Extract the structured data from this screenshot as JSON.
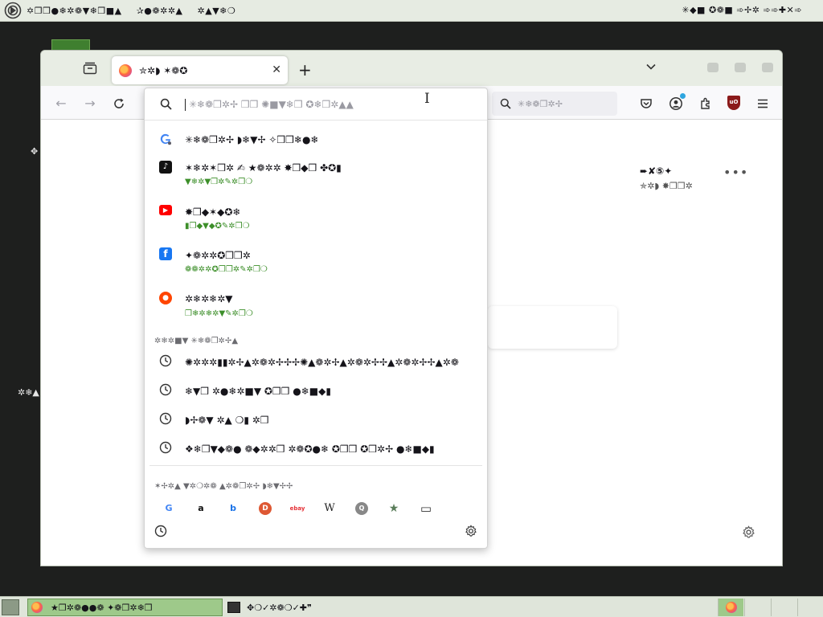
{
  "top_panel": {
    "menu_items": [
      "✡❒❒●❄✲❁▼❄❒■▲",
      "✰●❁✲✲▲",
      "✲▲▼❄❍"
    ],
    "clock": "✳◆■ ✪❁■ ➾✢✲ ➾➾✚✕➾"
  },
  "desktop": {
    "mark1": "✥",
    "mark2": "✲❄▲"
  },
  "browser": {
    "tab": {
      "title": "✮✲◗ ✶❁✪",
      "close_glyph": "✕"
    },
    "new_tab_glyph": "+",
    "navbar": {
      "search_placeholder": "✳❄❁❒✲✢",
      "ublock_label": "uO"
    },
    "urlbar": {
      "placeholder": "✳❄❁❒✲✢ ❒❒ ✺■▼❄❒ ✪❄❒✲▲▲"
    },
    "content": {
      "tile_title": "➨✘⑤✦",
      "tile_sub": "✯✲◗ ✸❒❒✲",
      "tile_more": "•••"
    }
  },
  "dropdown": {
    "results": [
      {
        "icon": "google-icon",
        "title": "✳❄❁❒✲✢ ◗❄▼✢ ✧❒❒❄●❄",
        "url": ""
      },
      {
        "icon": "tiktok-icon",
        "title": "✶❄✲✶❒✲ ✍ ★❁✲✲ ✸❒◆❒ ✤✪▮",
        "url": "▼❄✲▼❒✲✎✲❒❍"
      },
      {
        "icon": "youtube-icon",
        "title": "✸❒◆✶◆✪❄",
        "url": "▮❒◆▼◆✪✎✲❒❍"
      },
      {
        "icon": "facebook-icon",
        "title": "✦❁✲✲✪❒❒✲",
        "url": "❁❁✲✲✪❒❒✲✎✲❒❍"
      },
      {
        "icon": "reddit-icon",
        "title": "✲❄✲❄✲▼",
        "url": "❒❄✲❄✲▼✎✲❒❍"
      }
    ],
    "history_header": "✲❄✲■▼ ✳❄❁❒✲✢▲",
    "history": [
      "✺✲✲✲▮▮✲✢▲✲❁✲✢✢✢✺▲❁✲✢▲✲❁✲✢✢▲✲❁✲✢✢▲✲❁",
      "❄▼❒ ✲●❄✲■▼ ✪❒❒ ●❄■◆▮",
      "◗✢❁▼ ✲▲ ❍▮ ✲❒",
      "❖❄❒▼◆❁● ❁◆✲✲❒ ✲❁✪●❄ ✪❒❒ ✪❒✲✢ ●❄■◆▮"
    ],
    "engines_header": "✶✢✲▲ ▼✲❍✲❁ ▲✲❁❒✲✢ ◗❄▼✢✢",
    "engines": [
      {
        "name": "google-icon",
        "glyph": "G",
        "color": "#4285f4"
      },
      {
        "name": "amazon-icon",
        "glyph": "a",
        "color": "#111111"
      },
      {
        "name": "bing-icon",
        "glyph": "b",
        "color": "#1a73e8"
      },
      {
        "name": "duckduckgo-icon",
        "glyph": "D",
        "color": "#de5833"
      },
      {
        "name": "ebay-icon",
        "glyph": "ebay",
        "color": "#e53238"
      },
      {
        "name": "wikipedia-icon",
        "glyph": "W",
        "color": "#222222"
      },
      {
        "name": "search-engine-icon",
        "glyph": "Q",
        "color": "#777777"
      },
      {
        "name": "bookmarks-icon",
        "glyph": "★",
        "color": "#5a7d5a"
      },
      {
        "name": "tabs-icon",
        "glyph": "▭",
        "color": "#333333"
      }
    ]
  },
  "taskbar": {
    "task1": "★❒✲❁●●❁ ✦❁❒✲❄❒",
    "task2": "✥❍✓✲❁❍✓✚❞"
  }
}
